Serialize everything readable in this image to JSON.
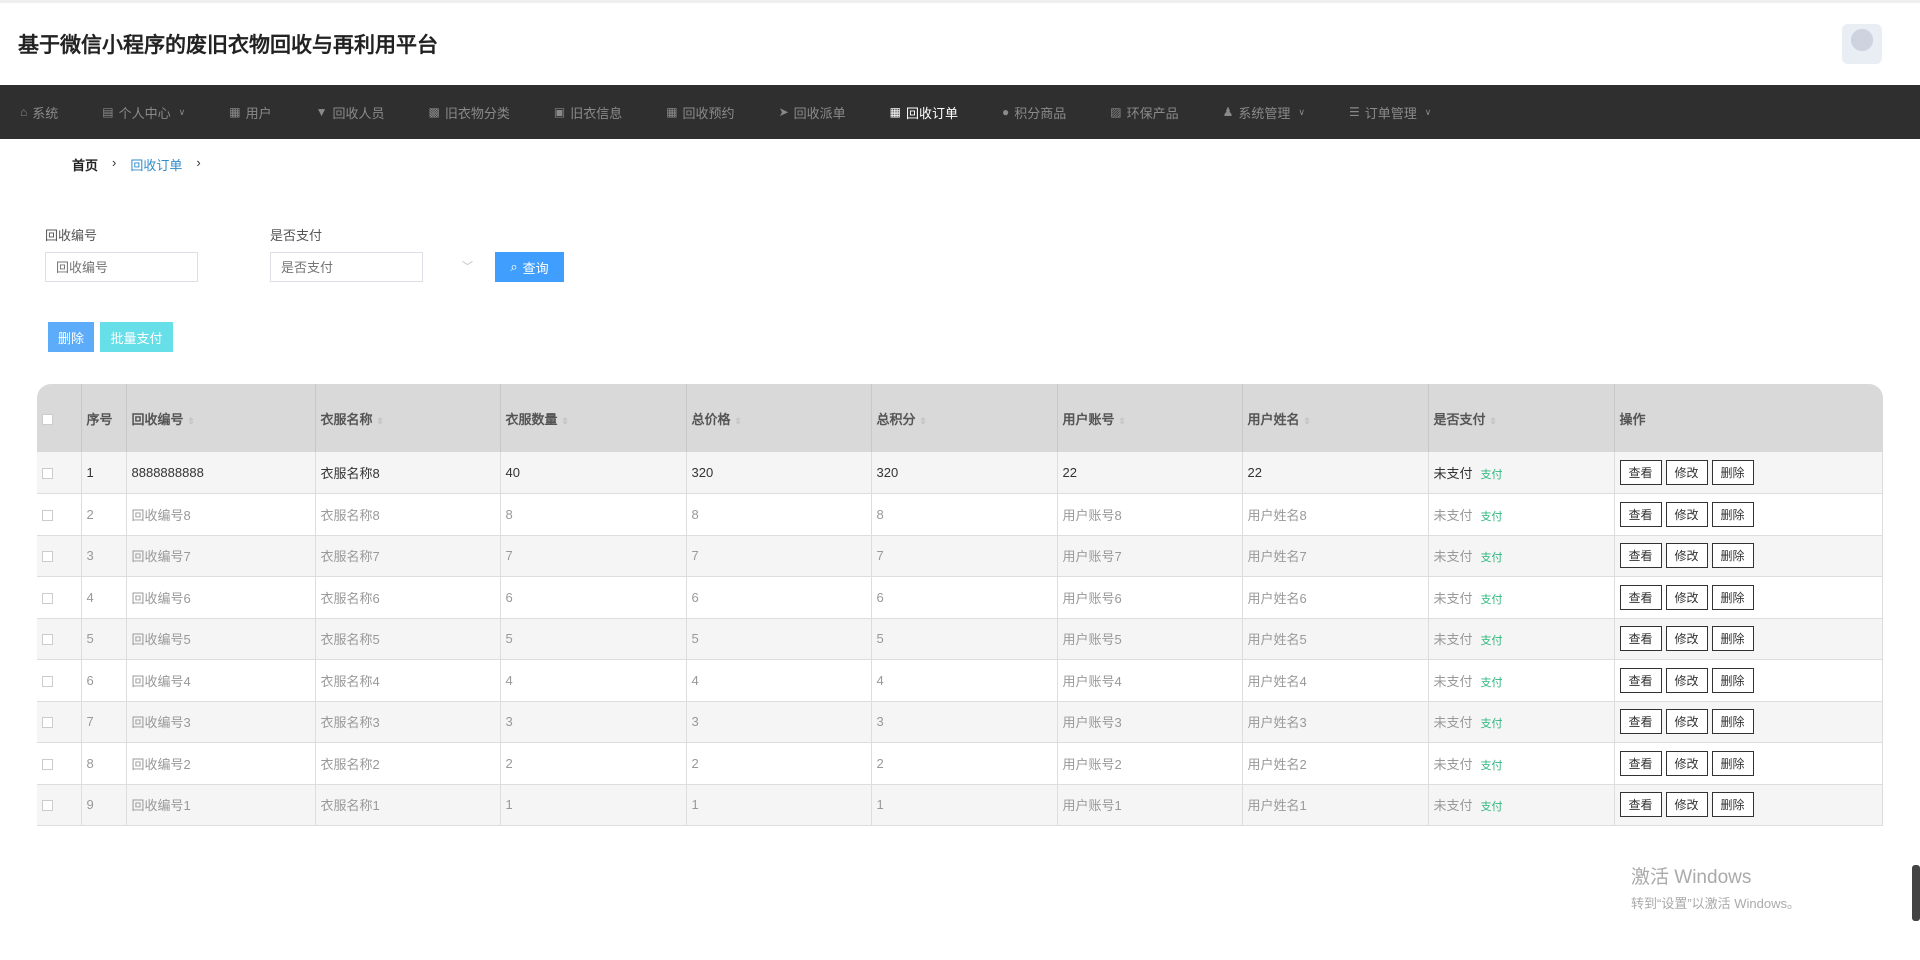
{
  "header": {
    "title": "基于微信小程序的废旧衣物回收与再利用平台"
  },
  "nav": [
    {
      "label": "系统",
      "icon": "home-icon",
      "glyph": "⌂",
      "dropdown": false
    },
    {
      "label": "个人中心",
      "icon": "calendar-icon",
      "glyph": "▤",
      "dropdown": true
    },
    {
      "label": "用户",
      "icon": "grid-icon",
      "glyph": "▦",
      "dropdown": false
    },
    {
      "label": "回收人员",
      "icon": "pin-icon",
      "glyph": "▼",
      "dropdown": false
    },
    {
      "label": "旧衣物分类",
      "icon": "ticket-icon",
      "glyph": "▩",
      "dropdown": false
    },
    {
      "label": "旧衣信息",
      "icon": "clipboard-icon",
      "glyph": "▣",
      "dropdown": false
    },
    {
      "label": "回收预约",
      "icon": "grid-icon",
      "glyph": "▦",
      "dropdown": false
    },
    {
      "label": "回收派单",
      "icon": "send-icon",
      "glyph": "➤",
      "dropdown": false
    },
    {
      "label": "回收订单",
      "icon": "grid-icon",
      "glyph": "▦",
      "dropdown": false,
      "active": true
    },
    {
      "label": "积分商品",
      "icon": "location-icon",
      "glyph": "●",
      "dropdown": false
    },
    {
      "label": "环保产品",
      "icon": "chart-icon",
      "glyph": "▨",
      "dropdown": false
    },
    {
      "label": "系统管理",
      "icon": "user-icon",
      "glyph": "♟",
      "dropdown": true
    },
    {
      "label": "订单管理",
      "icon": "sliders-icon",
      "glyph": "☰",
      "dropdown": true
    }
  ],
  "breadcrumb": {
    "home": "首页",
    "current": "回收订单",
    "sep": "›"
  },
  "filters": {
    "code_label": "回收编号",
    "code_placeholder": "回收编号",
    "pay_label": "是否支付",
    "pay_placeholder": "是否支付",
    "query": "查询"
  },
  "actions": {
    "delete": "删除",
    "batch_pay": "批量支付"
  },
  "table": {
    "headers": [
      "序号",
      "回收编号",
      "衣服名称",
      "衣服数量",
      "总价格",
      "总积分",
      "用户账号",
      "用户姓名",
      "是否支付",
      "操作"
    ],
    "pay_action": "支付",
    "view": "查看",
    "edit": "修改",
    "delete": "删除",
    "rows": [
      [
        "1",
        "8888888888",
        "衣服名称8",
        "40",
        "320",
        "320",
        "22",
        "22",
        "未支付"
      ],
      [
        "2",
        "回收编号8",
        "衣服名称8",
        "8",
        "8",
        "8",
        "用户账号8",
        "用户姓名8",
        "未支付"
      ],
      [
        "3",
        "回收编号7",
        "衣服名称7",
        "7",
        "7",
        "7",
        "用户账号7",
        "用户姓名7",
        "未支付"
      ],
      [
        "4",
        "回收编号6",
        "衣服名称6",
        "6",
        "6",
        "6",
        "用户账号6",
        "用户姓名6",
        "未支付"
      ],
      [
        "5",
        "回收编号5",
        "衣服名称5",
        "5",
        "5",
        "5",
        "用户账号5",
        "用户姓名5",
        "未支付"
      ],
      [
        "6",
        "回收编号4",
        "衣服名称4",
        "4",
        "4",
        "4",
        "用户账号4",
        "用户姓名4",
        "未支付"
      ],
      [
        "7",
        "回收编号3",
        "衣服名称3",
        "3",
        "3",
        "3",
        "用户账号3",
        "用户姓名3",
        "未支付"
      ],
      [
        "8",
        "回收编号2",
        "衣服名称2",
        "2",
        "2",
        "2",
        "用户账号2",
        "用户姓名2",
        "未支付"
      ],
      [
        "9",
        "回收编号1",
        "衣服名称1",
        "1",
        "1",
        "1",
        "用户账号1",
        "用户姓名1",
        "未支付"
      ]
    ]
  },
  "watermark": {
    "line1": "激活 Windows",
    "line2": "转到“设置”以激活 Windows。"
  },
  "colors": {
    "nav_bg": "#2f2f2f",
    "primary": "#409eff",
    "cyan": "#67e0e8",
    "pay_green": "#2db87d"
  }
}
